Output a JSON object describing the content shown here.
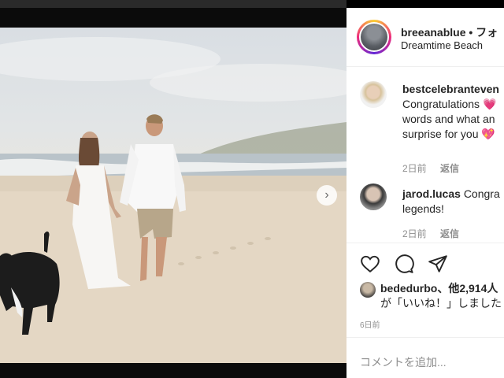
{
  "post": {
    "username": "breeanablue",
    "follow": "• フォ",
    "location": "Dreamtime Beach",
    "carousel": {
      "total_dots": 5,
      "active_index": 3,
      "next_icon": "chevron-right-icon"
    }
  },
  "comments": [
    {
      "username": "bestcelebranteven",
      "text_line1": "Congratulations 💗",
      "text_line2": "words and what an",
      "text_line3": "surprise for you 💖",
      "time": "2日前",
      "reply": "返信"
    },
    {
      "username": "jarod.lucas",
      "text_line1": "Congra",
      "text_line2": "legends!",
      "time": "2日前",
      "reply": "返信"
    }
  ],
  "actions": {
    "icons": [
      "heart-icon",
      "comment-icon",
      "share-icon"
    ]
  },
  "likes": {
    "line1": "bededurbo、他2,914人",
    "line2": "が「いいね！」しました"
  },
  "posted": "6日前",
  "add_comment_placeholder": "コメントを追加..."
}
